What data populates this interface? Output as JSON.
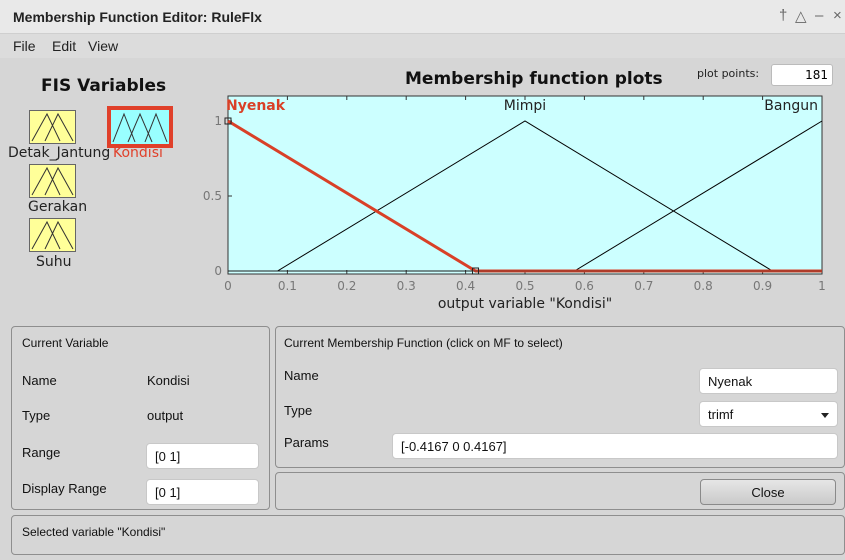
{
  "window": {
    "title": "Membership Function Editor: RuleFlx",
    "controls": [
      "†",
      "△",
      "–",
      "×"
    ]
  },
  "menu": [
    "File",
    "Edit",
    "View"
  ],
  "fis": {
    "title": "FIS Variables",
    "variables": [
      {
        "name": "Detak_Jantung",
        "type": "input",
        "color": "#ffff99"
      },
      {
        "name": "Kondisi",
        "type": "output",
        "color": "#99ffff",
        "selected": true
      },
      {
        "name": "Gerakan",
        "type": "input",
        "color": "#ffff99"
      },
      {
        "name": "Suhu",
        "type": "input",
        "color": "#ffff99"
      }
    ]
  },
  "plot": {
    "title": "Membership function plots",
    "plot_points_label": "plot points:",
    "plot_points": "181"
  },
  "chart_data": {
    "type": "line",
    "xlabel": "output variable \"Kondisi\"",
    "xlim": [
      0,
      1
    ],
    "ylim": [
      0,
      1
    ],
    "xticks": [
      "0",
      "0.1",
      "0.2",
      "0.3",
      "0.4",
      "0.5",
      "0.6",
      "0.7",
      "0.8",
      "0.9",
      "1"
    ],
    "yticks": [
      "0",
      "0.5",
      "1"
    ],
    "background": "#ccffff",
    "series": [
      {
        "name": "Nyenak",
        "params": [
          -0.4167,
          0,
          0.4167
        ],
        "color": "#d94027",
        "selected": true
      },
      {
        "name": "Mimpi",
        "params": [
          0.0833,
          0.5,
          0.9167
        ],
        "color": "#000000",
        "selected": false
      },
      {
        "name": "Bangun",
        "params": [
          0.5833,
          1,
          1.4167
        ],
        "color": "#000000",
        "selected": false
      }
    ]
  },
  "current_variable": {
    "heading": "Current Variable",
    "name_label": "Name",
    "name_value": "Kondisi",
    "type_label": "Type",
    "type_value": "output",
    "range_label": "Range",
    "range_value": "[0 1]",
    "display_range_label": "Display Range",
    "display_range_value": "[0 1]"
  },
  "current_mf": {
    "heading": "Current Membership Function (click on MF to select)",
    "name_label": "Name",
    "name_value": "Nyenak",
    "type_label": "Type",
    "type_value": "trimf",
    "params_label": "Params",
    "params_value": "[-0.4167 0 0.4167]"
  },
  "close_label": "Close",
  "status": "Selected variable \"Kondisi\""
}
